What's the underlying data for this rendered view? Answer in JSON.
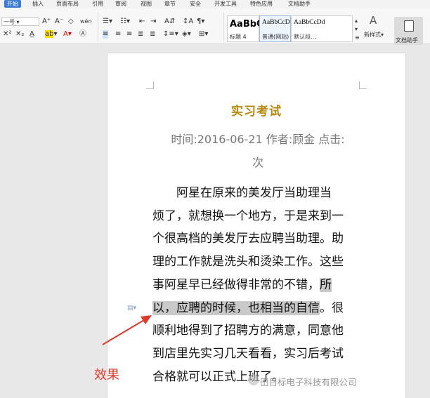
{
  "menu": {
    "tabs": [
      "开始",
      "插入",
      "页面布局",
      "引用",
      "审阅",
      "视图",
      "章节",
      "安全",
      "开发工具",
      "特色应用",
      "文档助手"
    ],
    "active_tab": "开始"
  },
  "ribbon": {
    "font_name": "一号",
    "font_sample_labels": [
      "A⁺",
      "A⁻",
      "◇",
      "wén"
    ],
    "styles": [
      {
        "sample": "AaBbC",
        "caption": "标题 4"
      },
      {
        "sample": "AaBbCcD",
        "caption": "普通(网站)"
      },
      {
        "sample": "AaBbCcDd",
        "caption": "默认段..."
      }
    ],
    "new_style_label": "新样式",
    "doc_assistant_label": "文档助手"
  },
  "document": {
    "title": "实习考试",
    "meta_line1": "时间:2016-06-21  作者:顾金  点击:",
    "meta_line2": "次",
    "lines": [
      {
        "pre": "　　阿星在原来的美发厅当助理当",
        "hl": "",
        "post": ""
      },
      {
        "pre": "烦了，就想换一个地方，于是来到一",
        "hl": "",
        "post": ""
      },
      {
        "pre": "个很高档的美发厅去应聘当助理。助",
        "hl": "",
        "post": ""
      },
      {
        "pre": "理的工作就是洗头和烫染工作。这些",
        "hl": "",
        "post": ""
      },
      {
        "pre": "事阿星早已经做得非常的不错，",
        "hl": "所",
        "post": ""
      },
      {
        "pre": "",
        "hl": "以，应聘的时候，也相当的自信",
        "post": "。很"
      },
      {
        "pre": "顺利地得到了招聘方的满意，同意他",
        "hl": "",
        "post": ""
      },
      {
        "pre": "到店里先实习几天看看，实习后考试",
        "hl": "",
        "post": ""
      },
      {
        "pre": "合格就可以正式上班了。",
        "hl": "",
        "post": ""
      }
    ]
  },
  "annotation": {
    "effect_label": "效果",
    "watermark": "田目标电子科技有限公司",
    "arrow_color": "#e03a2a"
  }
}
